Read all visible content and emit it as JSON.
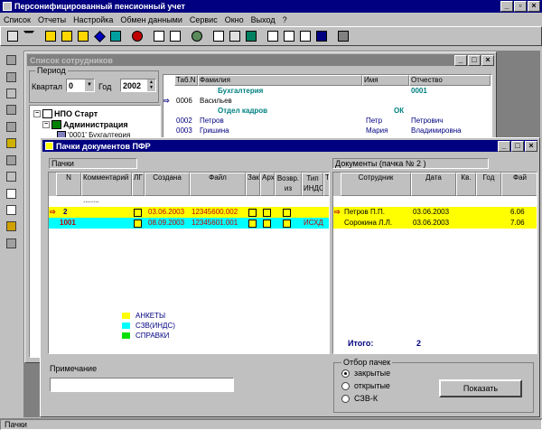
{
  "app": {
    "title": "Персонифицированный пенсионный учет"
  },
  "menu": [
    "Список",
    "Отчеты",
    "Настройка",
    "Обмен данными",
    "Сервис",
    "Окно",
    "Выход",
    "?"
  ],
  "status": "Пачки",
  "employees_window": {
    "title": "Список сотрудников",
    "period_label": "Период",
    "quarter_label": "Квартал",
    "quarter_value": "0",
    "year_label": "Год",
    "year_value": "2002",
    "columns": [
      "Таб.N",
      "Фамилия",
      "Имя",
      "Отчество"
    ],
    "rows": [
      {
        "tab": "",
        "surname": "Бухгалтерия",
        "name": "0001",
        "patronymic": "",
        "kind": "dept"
      },
      {
        "tab": "0006",
        "surname": "Васильев",
        "name": "",
        "patronymic": "",
        "kind": "current"
      },
      {
        "tab": "",
        "surname": "Отдел кадров",
        "name": "ОК",
        "patronymic": "",
        "kind": "dept"
      },
      {
        "tab": "0002",
        "surname": "Петров",
        "name": "Петр",
        "patronymic": "Петрович",
        "kind": "person"
      },
      {
        "tab": "0003",
        "surname": "Гришина",
        "name": "Мария",
        "patronymic": "Владимировна",
        "kind": "person"
      }
    ],
    "tree": {
      "root": "НПО Старт",
      "child": "Администрация",
      "leaf": "'0001' Бухгалтерия"
    }
  },
  "packs_window": {
    "title": "Пачки документов ПФР",
    "packs_label": "Пачки",
    "docs_label": "Документы (пачка № 2 )",
    "pack_columns": [
      "N",
      "Комментарий",
      "ЛГ",
      "Создана",
      "Файл",
      "Закр.",
      "Арх.",
      "Возвр. из",
      "Тип ИНДС",
      "Т"
    ],
    "pack_filter_row": "........",
    "packs": [
      {
        "n": "2",
        "comment": "",
        "created": "03.06.2003",
        "file": "12345600.002",
        "type": "",
        "color": "#ffff00"
      },
      {
        "n": "1001",
        "comment": "",
        "created": "08.09.2003",
        "file": "12345601.001",
        "type": "ИСХД",
        "color": "#00ffff"
      }
    ],
    "doc_columns": [
      "Сотрудник",
      "Дата",
      "Кв.",
      "Год",
      "Фай"
    ],
    "docs": [
      {
        "employee": "Петров П.П.",
        "date": "03.06.2003",
        "q": "",
        "year": "",
        "file": "6.06"
      },
      {
        "employee": "Сорокина Л.Л.",
        "date": "03.06.2003",
        "q": "",
        "year": "",
        "file": "7.06"
      }
    ],
    "legend": [
      {
        "label": "АНКЕТЫ",
        "color": "#ffff00"
      },
      {
        "label": "СЗВ(ИНДС)",
        "color": "#00ffff"
      },
      {
        "label": "СПРАВКИ",
        "color": "#00e000"
      }
    ],
    "total_label": "Итого:",
    "total_value": "2",
    "note_label": "Примечание",
    "note_value": "",
    "filter": {
      "title": "Отбор пачек",
      "options": [
        "закрытые",
        "открытые",
        "СЗВ-К"
      ],
      "selected": 0,
      "show_button": "Показать"
    }
  }
}
